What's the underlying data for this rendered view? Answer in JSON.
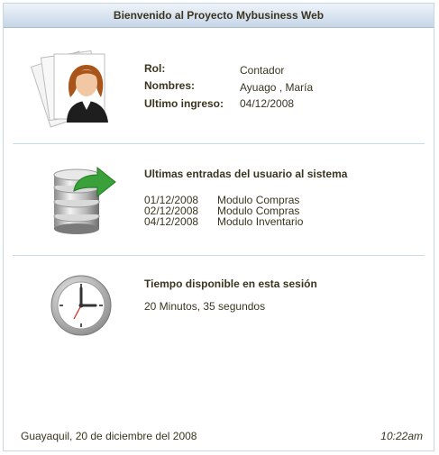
{
  "header": {
    "title": "Bienvenido al Proyecto Mybusiness Web"
  },
  "user": {
    "icon": "user-profile-icon",
    "rol_label": "Rol:",
    "rol_value": "Contador",
    "nombres_label": "Nombres:",
    "nombres_value": "Ayuago , María",
    "ultimo_label": "Ultimo ingreso:",
    "ultimo_value": "04/12/2008"
  },
  "entries": {
    "icon": "database-icon",
    "title": "Ultimas entradas del usuario al sistema",
    "rows": [
      {
        "date": "01/12/2008",
        "module": "Modulo Compras"
      },
      {
        "date": "02/12/2008",
        "module": "Modulo Compras"
      },
      {
        "date": "04/12/2008",
        "module": "Modulo Inventario"
      }
    ]
  },
  "session": {
    "icon": "clock-icon",
    "title": "Tiempo disponible en esta sesión",
    "remaining": "20 Minutos, 35 segundos"
  },
  "footer": {
    "location_date": "Guayaquil, 20 de diciembre del 2008",
    "time": "10:22am"
  }
}
